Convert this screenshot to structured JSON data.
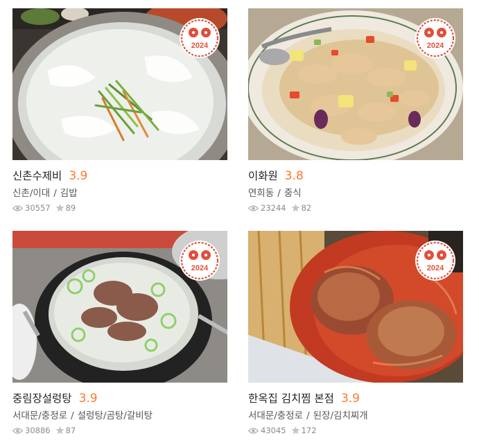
{
  "colors": {
    "rating": "#ff792a",
    "badge": "#e0503c",
    "meta": "#8a8a8a"
  },
  "badge_icon": "two-star-2024-badge",
  "restaurants": [
    {
      "name": "신촌수제비",
      "rating": "3.9",
      "area": "신촌/이대",
      "category": "김밥",
      "views": "30557",
      "favorites": "89",
      "badge_year": "2024"
    },
    {
      "name": "이화원",
      "rating": "3.8",
      "area": "연희동",
      "category": "중식",
      "views": "23244",
      "favorites": "82",
      "badge_year": "2024"
    },
    {
      "name": "중림장설렁탕",
      "rating": "3.9",
      "area": "서대문/충정로",
      "category": "설렁탕/곰탕/갈비탕",
      "views": "30886",
      "favorites": "87",
      "badge_year": "2024"
    },
    {
      "name": "한옥집 김치찜 본점",
      "rating": "3.9",
      "area": "서대문/충정로",
      "category": "된장/김치찌개",
      "views": "43045",
      "favorites": "172",
      "badge_year": "2024"
    }
  ]
}
